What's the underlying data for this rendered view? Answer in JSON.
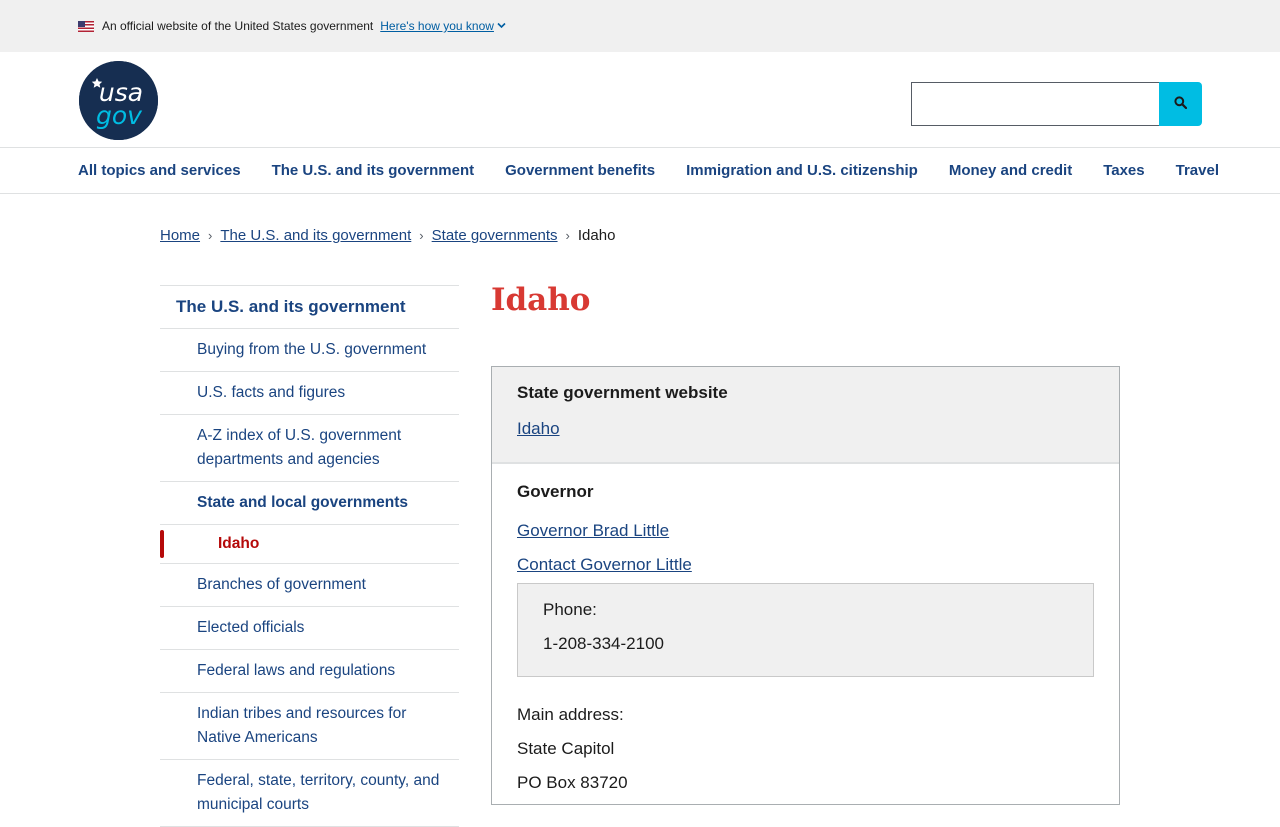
{
  "banner": {
    "text": "An official website of the United States government",
    "link": "Here's how you know"
  },
  "logo": {
    "line1": "usa",
    "line2": "gov"
  },
  "search": {
    "placeholder": ""
  },
  "nav": [
    "All topics and services",
    "The U.S. and its government",
    "Government benefits",
    "Immigration and U.S. citizenship",
    "Money and credit",
    "Taxes",
    "Travel"
  ],
  "breadcrumb": {
    "items": [
      "Home",
      "The U.S. and its government",
      "State governments"
    ],
    "current": "Idaho"
  },
  "sidebar": {
    "heading": "The U.S. and its government",
    "items": [
      "Buying from the U.S. government",
      "U.S. facts and figures",
      "A-Z index of U.S. government departments and agencies",
      "State and local governments",
      "Idaho",
      "Branches of government",
      "Elected officials",
      "Federal laws and regulations",
      "Indian tribes and resources for Native Americans",
      "Federal, state, territory, county, and municipal courts"
    ]
  },
  "page": {
    "title": "Idaho"
  },
  "card": {
    "website_label": "State government website",
    "website_link": "Idaho",
    "governor_label": "Governor",
    "governor_link": "Governor Brad Little",
    "contact_link": "Contact Governor Little",
    "phone_label": "Phone:",
    "phone_number": "1-208-334-2100",
    "address_label": "Main address:",
    "address_line1": "State Capitol",
    "address_line2": "PO Box 83720"
  },
  "colors": {
    "title_red": "#d83933",
    "nav_blue": "#1a4480",
    "search_button": "#00bde3",
    "active_red": "#b50909"
  }
}
